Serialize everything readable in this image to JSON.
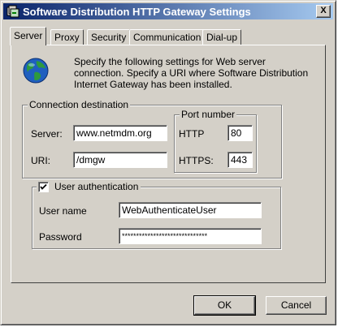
{
  "window": {
    "title": "Software Distribution HTTP Gateway Settings",
    "close_label": "X"
  },
  "tabs": [
    {
      "label": "Server",
      "active": true
    },
    {
      "label": "Proxy",
      "active": false
    },
    {
      "label": "Security",
      "active": false
    },
    {
      "label": "Communication",
      "active": false
    },
    {
      "label": "Dial-up",
      "active": false
    }
  ],
  "intro_text": "Specify the following settings for Web server connection. Specify a URI where Software Distribution Internet Gateway has been installed.",
  "connection": {
    "legend": "Connection destination",
    "server_label": "Server:",
    "server_value": "www.netmdm.org",
    "uri_label": "URI:",
    "uri_value": "/dmgw"
  },
  "ports": {
    "legend": "Port number",
    "http_label": "HTTP",
    "http_value": "80",
    "https_label": "HTTPS:",
    "https_value": "443"
  },
  "auth": {
    "checkbox_label": "User authentication",
    "checked": true,
    "username_label": "User name",
    "username_value": "WebAuthenticateUser",
    "password_label": "Password",
    "password_value": "******************************"
  },
  "buttons": {
    "ok": "OK",
    "cancel": "Cancel"
  },
  "colors": {
    "titlebar_start": "#0a246a",
    "titlebar_end": "#a6caf0",
    "face": "#d4d0c8"
  }
}
